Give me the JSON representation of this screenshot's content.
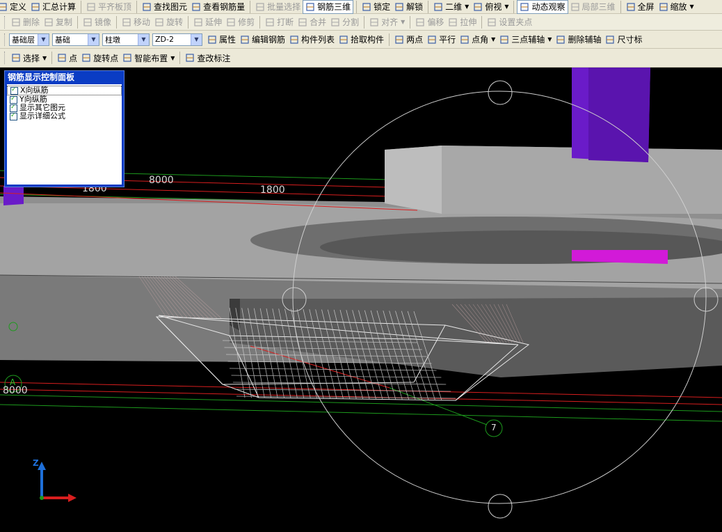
{
  "toolbar1": {
    "items": [
      {
        "label": "定义",
        "icon": "define-icon",
        "disabled": false
      },
      {
        "label": "汇总计算",
        "icon": "sigma-icon",
        "disabled": false
      },
      {
        "label": "平齐板顶",
        "icon": "flush-icon",
        "disabled": true
      },
      {
        "label": "查找图元",
        "icon": "binoculars-icon",
        "disabled": false
      },
      {
        "label": "查看钢筋量",
        "icon": "glasses-icon",
        "disabled": false
      },
      {
        "label": "批量选择",
        "icon": "batch-select-icon",
        "disabled": true
      },
      {
        "label": "钢筋三维",
        "icon": "rebar-3d-icon",
        "disabled": false,
        "active": true
      },
      {
        "label": "锁定",
        "icon": "lock-icon",
        "disabled": false
      },
      {
        "label": "解锁",
        "icon": "unlock-icon",
        "disabled": false
      },
      {
        "label": "二维",
        "icon": "view-2d-icon",
        "disabled": false,
        "dropdown": true
      },
      {
        "label": "俯视",
        "icon": "top-view-icon",
        "disabled": false,
        "dropdown": true
      },
      {
        "label": "动态观察",
        "icon": "orbit-icon",
        "disabled": false,
        "active": true
      },
      {
        "label": "局部三维",
        "icon": "local-3d-icon",
        "disabled": true
      },
      {
        "label": "全屏",
        "icon": "fullscreen-icon",
        "disabled": false
      },
      {
        "label": "缩放",
        "icon": "zoom-icon",
        "disabled": false,
        "dropdown": true
      }
    ]
  },
  "toolbar2": {
    "items": [
      {
        "label": "删除",
        "icon": "delete-icon"
      },
      {
        "label": "复制",
        "icon": "copy-icon"
      },
      {
        "label": "镜像",
        "icon": "mirror-icon"
      },
      {
        "label": "移动",
        "icon": "move-icon"
      },
      {
        "label": "旋转",
        "icon": "rotate-icon"
      },
      {
        "label": "延伸",
        "icon": "extend-icon"
      },
      {
        "label": "修剪",
        "icon": "trim-icon"
      },
      {
        "label": "打断",
        "icon": "break-icon"
      },
      {
        "label": "合并",
        "icon": "merge-icon"
      },
      {
        "label": "分割",
        "icon": "split-icon"
      },
      {
        "label": "对齐",
        "icon": "align-icon",
        "dropdown": true
      },
      {
        "label": "偏移",
        "icon": "offset-icon"
      },
      {
        "label": "拉伸",
        "icon": "stretch-icon"
      },
      {
        "label": "设置夹点",
        "icon": "grip-point-icon"
      }
    ]
  },
  "toolbar3": {
    "layer_select": "基础层",
    "category_select": "基础",
    "type_select": "柱墩",
    "name_select": "ZD-2",
    "actions": [
      {
        "label": "属性",
        "icon": "properties-icon"
      },
      {
        "label": "编辑钢筋",
        "icon": "edit-rebar-icon"
      },
      {
        "label": "构件列表",
        "icon": "component-list-icon"
      },
      {
        "label": "拾取构件",
        "icon": "pick-component-icon"
      }
    ],
    "axis_tools": [
      {
        "label": "两点",
        "icon": "two-point-axis-icon"
      },
      {
        "label": "平行",
        "icon": "parallel-axis-icon"
      },
      {
        "label": "点角",
        "icon": "point-angle-axis-icon",
        "dropdown": true
      },
      {
        "label": "三点辅轴",
        "icon": "three-point-axis-icon",
        "dropdown": true
      },
      {
        "label": "删除辅轴",
        "icon": "delete-axis-icon"
      },
      {
        "label": "尺寸标",
        "icon": "dimension-icon"
      }
    ]
  },
  "toolbar4": {
    "items": [
      {
        "label": "选择",
        "icon": "select-cursor-icon",
        "dropdown": true
      },
      {
        "label": "点",
        "icon": "point-icon"
      },
      {
        "label": "旋转点",
        "icon": "rotate-point-icon"
      },
      {
        "label": "智能布置",
        "icon": "smart-layout-icon",
        "dropdown": true
      },
      {
        "label": "查改标注",
        "icon": "edit-annotation-icon"
      }
    ]
  },
  "panel": {
    "title": "钢筋显示控制面板",
    "options": [
      {
        "label": "X向纵筋",
        "checked": true
      },
      {
        "label": "Y向纵筋",
        "checked": true
      },
      {
        "label": "显示其它图元",
        "checked": true
      },
      {
        "label": "显示详细公式",
        "checked": true
      }
    ]
  },
  "viewport": {
    "dimension_labels": [
      "1800",
      "8000",
      "1800",
      "8000"
    ],
    "axis_bubble_A": "A",
    "axis_bubble_7": "7",
    "axis_z": "Z",
    "colors": {
      "background": "#000000",
      "slab": "#a6a6a6",
      "column_purple": "#6a1bc9",
      "column_magenta": "#d21ad8",
      "rebar": "#e8e8e8",
      "axis_red": "#d81e1e",
      "axis_green": "#1d9a1d",
      "z_axis": "#1e6fd8"
    }
  }
}
